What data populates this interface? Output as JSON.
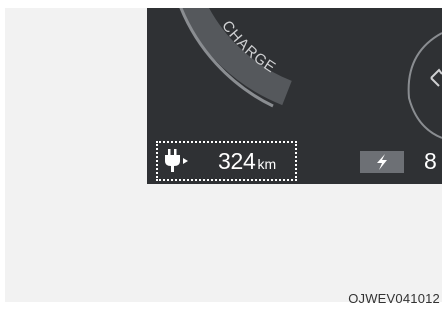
{
  "gauge": {
    "label": "CHARGE",
    "label_color": "#cfd0d2"
  },
  "range": {
    "value": "324",
    "unit": "km",
    "icon": "ev-plug-icon"
  },
  "battery": {
    "icon": "lightning-bolt-icon",
    "value": "8"
  },
  "colors": {
    "panel": "#2f3134",
    "outline": "#ffffff",
    "bolt_box": "#6d7075"
  },
  "caption": "OJWEV041012"
}
